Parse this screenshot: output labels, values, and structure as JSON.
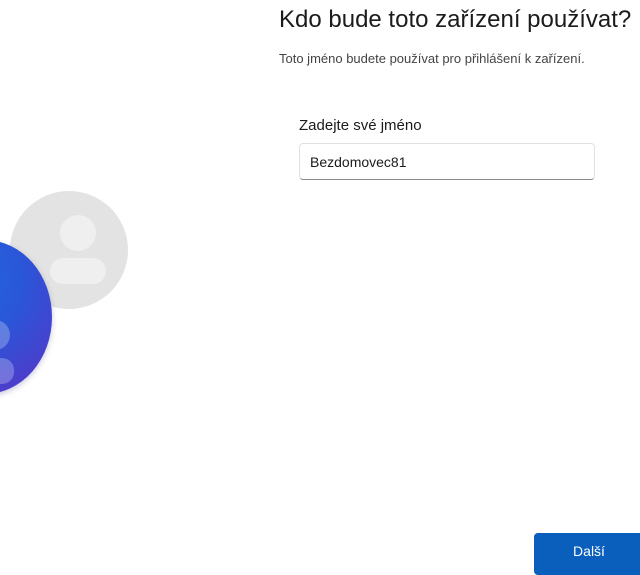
{
  "page": {
    "title": "Kdo bude toto zařízení používat?",
    "subtitle": "Toto jméno budete používat pro přihlášení k zařízení."
  },
  "form": {
    "name_label": "Zadejte své jméno",
    "name_value": "Bezdomovec81"
  },
  "actions": {
    "next_label": "Další"
  },
  "illustration": {
    "icons": [
      "user-avatar-grey-icon",
      "user-avatar-blue-icon"
    ]
  },
  "colors": {
    "accent": "#0a5fbd",
    "avatar_grey": "#e3e3e3",
    "avatar_blue": "#2b55d8"
  }
}
